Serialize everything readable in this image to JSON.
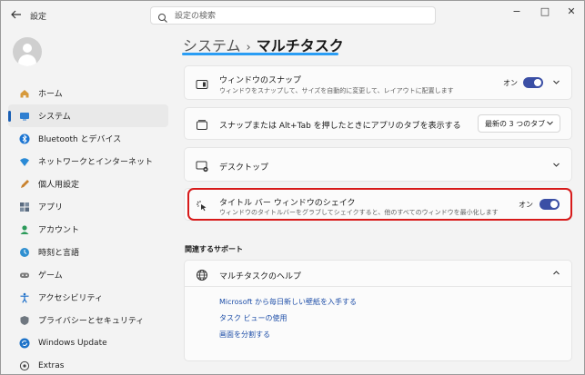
{
  "app": {
    "title": "設定"
  },
  "search": {
    "placeholder": "設定の検索"
  },
  "window_controls": {
    "minimize": "−",
    "maximize": "□",
    "close": "✕"
  },
  "sidebar": {
    "items": [
      {
        "label": "ホーム",
        "icon": "home-icon",
        "active": false
      },
      {
        "label": "システム",
        "icon": "system-icon",
        "active": true
      },
      {
        "label": "Bluetooth とデバイス",
        "icon": "bluetooth-icon",
        "active": false
      },
      {
        "label": "ネットワークとインターネット",
        "icon": "network-icon",
        "active": false
      },
      {
        "label": "個人用設定",
        "icon": "personalization-icon",
        "active": false
      },
      {
        "label": "アプリ",
        "icon": "apps-icon",
        "active": false
      },
      {
        "label": "アカウント",
        "icon": "account-icon",
        "active": false
      },
      {
        "label": "時刻と言語",
        "icon": "time-language-icon",
        "active": false
      },
      {
        "label": "ゲーム",
        "icon": "gaming-icon",
        "active": false
      },
      {
        "label": "アクセシビリティ",
        "icon": "accessibility-icon",
        "active": false
      },
      {
        "label": "プライバシーとセキュリティ",
        "icon": "privacy-icon",
        "active": false
      },
      {
        "label": "Windows Update",
        "icon": "windows-update-icon",
        "active": false
      },
      {
        "label": "Extras",
        "icon": "extras-icon",
        "active": false
      }
    ]
  },
  "breadcrumb": {
    "parent": "システム",
    "separator": "›",
    "current": "マルチタスク"
  },
  "settings": {
    "snap": {
      "title": "ウィンドウのスナップ",
      "description": "ウィンドウをスナップして、サイズを自動的に変更して、レイアウトに配置します",
      "toggle_label": "オン",
      "enabled": true
    },
    "alttab": {
      "title": "スナップまたは Alt+Tab を押したときにアプリのタブを表示する",
      "dropdown_value": "最新の 3 つのタブ"
    },
    "desktops": {
      "title": "デスクトップ"
    },
    "shake": {
      "title": "タイトル バー ウィンドウのシェイク",
      "description": "ウィンドウのタイトルバーをグラブしてシェイクすると、他のすべてのウィンドウを最小化します",
      "toggle_label": "オン",
      "enabled": true
    }
  },
  "support": {
    "heading": "関連するサポート",
    "help_title": "マルチタスクのヘルプ",
    "links": [
      "Microsoft から毎日新しい壁紙を入手する",
      "タスク ビューの使用",
      "画面を分割する"
    ]
  },
  "colors": {
    "accent": "#3b4fa5",
    "highlight_border": "#d71a1a",
    "link": "#1f4fa8",
    "underline": "#2a9df4"
  }
}
